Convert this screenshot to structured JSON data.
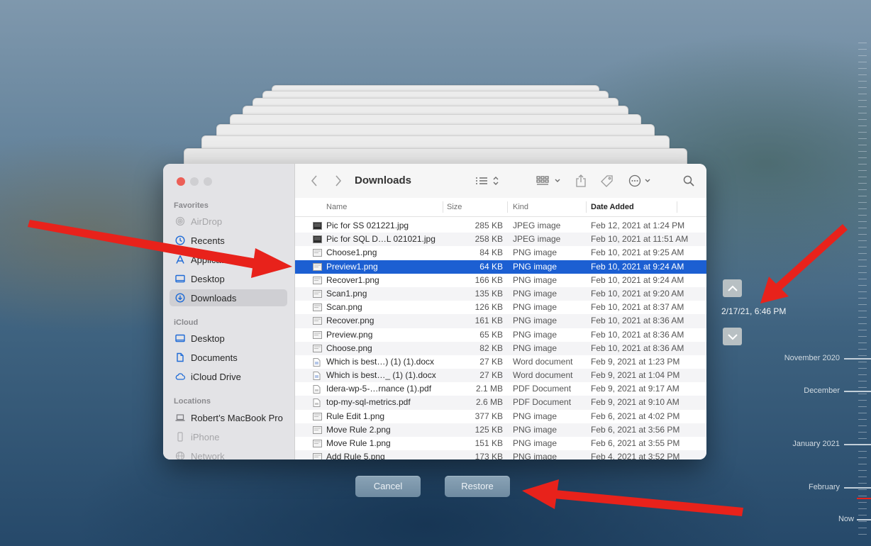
{
  "sidebar": {
    "favorites_header": "Favorites",
    "icloud_header": "iCloud",
    "locations_header": "Locations",
    "favorites": [
      {
        "label": "AirDrop",
        "icon": "airdrop-icon",
        "dim": true
      },
      {
        "label": "Recents",
        "icon": "clock-icon",
        "dim": false
      },
      {
        "label": "Applications",
        "icon": "applications-icon",
        "dim": false
      },
      {
        "label": "Desktop",
        "icon": "desktop-icon",
        "dim": false
      },
      {
        "label": "Downloads",
        "icon": "downloads-icon",
        "dim": false,
        "selected": true
      }
    ],
    "icloud": [
      {
        "label": "Desktop",
        "icon": "desktop-icon"
      },
      {
        "label": "Documents",
        "icon": "document-icon"
      },
      {
        "label": "iCloud Drive",
        "icon": "cloud-icon"
      }
    ],
    "locations": [
      {
        "label": "Robert’s MacBook Pro",
        "icon": "laptop-icon",
        "dim": false
      },
      {
        "label": "iPhone",
        "icon": "phone-icon",
        "dim": true
      },
      {
        "label": "Network",
        "icon": "globe-icon",
        "dim": true
      }
    ]
  },
  "toolbar": {
    "title": "Downloads"
  },
  "columns": {
    "name": "Name",
    "size": "Size",
    "kind": "Kind",
    "date": "Date Added"
  },
  "files": [
    {
      "name": "Pic for SS 021221.jpg",
      "size": "285 KB",
      "kind": "JPEG image",
      "date": "Feb 12, 2021 at 1:24 PM",
      "icon": "jpeg-thumb-icon"
    },
    {
      "name": "Pic for SQL D…L 021021.jpg",
      "size": "258 KB",
      "kind": "JPEG image",
      "date": "Feb 10, 2021 at 11:51 AM",
      "icon": "jpeg-thumb-icon"
    },
    {
      "name": "Choose1.png",
      "size": "84 KB",
      "kind": "PNG image",
      "date": "Feb 10, 2021 at 9:25 AM",
      "icon": "png-thumb-icon"
    },
    {
      "name": "Preview1.png",
      "size": "64 KB",
      "kind": "PNG image",
      "date": "Feb 10, 2021 at 9:24 AM",
      "icon": "png-thumb-icon",
      "selected": true
    },
    {
      "name": "Recover1.png",
      "size": "166 KB",
      "kind": "PNG image",
      "date": "Feb 10, 2021 at 9:24 AM",
      "icon": "png-thumb-icon"
    },
    {
      "name": "Scan1.png",
      "size": "135 KB",
      "kind": "PNG image",
      "date": "Feb 10, 2021 at 9:20 AM",
      "icon": "png-thumb-icon"
    },
    {
      "name": "Scan.png",
      "size": "126 KB",
      "kind": "PNG image",
      "date": "Feb 10, 2021 at 8:37 AM",
      "icon": "png-thumb-icon"
    },
    {
      "name": "Recover.png",
      "size": "161 KB",
      "kind": "PNG image",
      "date": "Feb 10, 2021 at 8:36 AM",
      "icon": "png-thumb-icon"
    },
    {
      "name": "Preview.png",
      "size": "65 KB",
      "kind": "PNG image",
      "date": "Feb 10, 2021 at 8:36 AM",
      "icon": "png-thumb-icon"
    },
    {
      "name": "Choose.png",
      "size": "82 KB",
      "kind": "PNG image",
      "date": "Feb 10, 2021 at 8:36 AM",
      "icon": "png-thumb-icon"
    },
    {
      "name": "Which is best…) (1) (1).docx",
      "size": "27 KB",
      "kind": "Word document",
      "date": "Feb 9, 2021 at 1:23 PM",
      "icon": "doc-icon"
    },
    {
      "name": "Which is best…_ (1) (1).docx",
      "size": "27 KB",
      "kind": "Word document",
      "date": "Feb 9, 2021 at 1:04 PM",
      "icon": "doc-icon"
    },
    {
      "name": "Idera-wp-5-…rnance (1).pdf",
      "size": "2.1 MB",
      "kind": "PDF Document",
      "date": "Feb 9, 2021 at 9:17 AM",
      "icon": "pdf-icon"
    },
    {
      "name": "top-my-sql-metrics.pdf",
      "size": "2.6 MB",
      "kind": "PDF Document",
      "date": "Feb 9, 2021 at 9:10 AM",
      "icon": "pdf-icon"
    },
    {
      "name": "Rule Edit 1.png",
      "size": "377 KB",
      "kind": "PNG image",
      "date": "Feb 6, 2021 at 4:02 PM",
      "icon": "png-thumb-icon"
    },
    {
      "name": "Move Rule 2.png",
      "size": "125 KB",
      "kind": "PNG image",
      "date": "Feb 6, 2021 at 3:56 PM",
      "icon": "png-thumb-icon"
    },
    {
      "name": "Move Rule 1.png",
      "size": "151 KB",
      "kind": "PNG image",
      "date": "Feb 6, 2021 at 3:55 PM",
      "icon": "png-thumb-icon"
    },
    {
      "name": "Add Rule 5.png",
      "size": "173 KB",
      "kind": "PNG image",
      "date": "Feb 4, 2021 at 3:52 PM",
      "icon": "png-thumb-icon"
    }
  ],
  "buttons": {
    "cancel": "Cancel",
    "restore": "Restore"
  },
  "timemachine": {
    "timestamp": "2/17/21, 6:46 PM",
    "timeline": [
      "November 2020",
      "December",
      "January 2021",
      "February",
      "Now"
    ]
  },
  "colors": {
    "selection": "#1c5fd2",
    "annotation_arrow": "#e8221b"
  }
}
